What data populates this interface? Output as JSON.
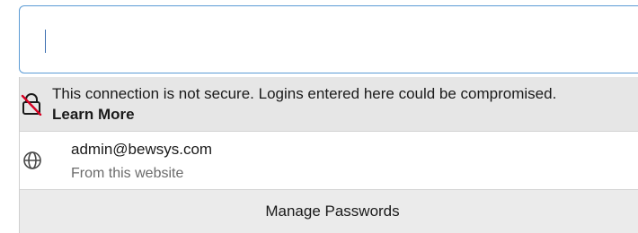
{
  "input": {
    "value": "",
    "focused": true
  },
  "warning": {
    "message": "This connection is not secure. Logins entered here could be compromised.",
    "learn_more": "Learn More",
    "icon": "insecure-lock-icon",
    "background": "#e6e6e6"
  },
  "saved_login": {
    "username": "admin@bewsys.com",
    "source": "From this website",
    "icon": "globe-icon"
  },
  "footer": {
    "manage_label": "Manage Passwords"
  },
  "colors": {
    "input_border": "#5b9bd5",
    "insecure_slash": "#d70022"
  }
}
